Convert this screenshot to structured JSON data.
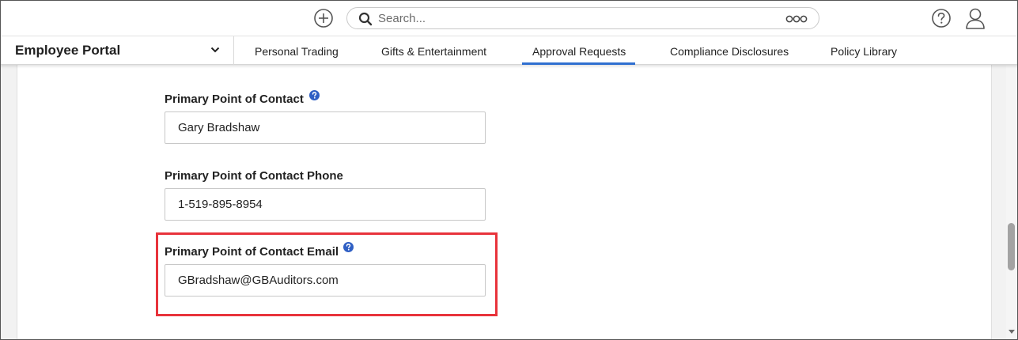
{
  "topbar": {
    "add_icon": "plus-circle-icon",
    "search": {
      "placeholder": "Search...",
      "search_icon": "search-icon",
      "more_icon": "more-options-icon"
    },
    "help_icon": "help-circle-icon",
    "user_icon": "user-profile-icon"
  },
  "nav": {
    "portal_title": "Employee Portal",
    "tabs": [
      {
        "label": "Personal Trading",
        "active": false
      },
      {
        "label": "Gifts & Entertainment",
        "active": false
      },
      {
        "label": "Approval Requests",
        "active": true
      },
      {
        "label": "Compliance Disclosures",
        "active": false
      },
      {
        "label": "Policy Library",
        "active": false
      }
    ]
  },
  "form": {
    "fields": [
      {
        "label": "Primary Point of Contact",
        "value": "Gary Bradshaw",
        "has_help": true
      },
      {
        "label": "Primary Point of Contact Phone",
        "value": "1-519-895-8954",
        "has_help": false
      },
      {
        "label": "Primary Point of Contact Email",
        "value": "GBradshaw@GBAuditors.com",
        "has_help": true
      }
    ]
  },
  "colors": {
    "accent": "#2f6fd0",
    "highlight": "#e8333b",
    "help_icon": "#2f5fc4"
  }
}
